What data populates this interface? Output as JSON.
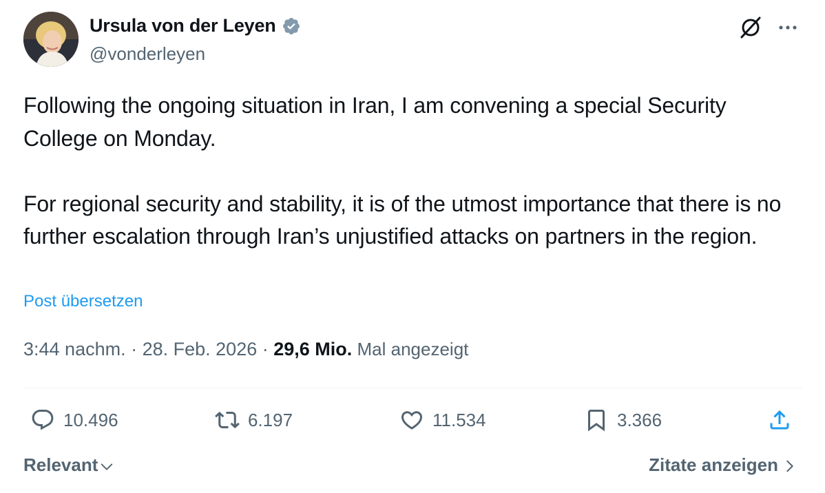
{
  "author": {
    "display_name": "Ursula von der Leyen",
    "handle": "@vonderleyen",
    "verified_icon": "verified-badge-icon",
    "badge_color": "#829aab"
  },
  "tweet": {
    "text": "Following the ongoing situation in Iran, I am convening a special Security College on Monday.\n\nFor regional security and stability, it is of the utmost importance that there is no further escalation through Iran’s unjustified attacks on partners in the region.",
    "translate_label": "Post übersetzen"
  },
  "meta": {
    "time": "3:44 nachm.",
    "sep1": " · ",
    "date": "28. Feb. 2026",
    "sep2": " · ",
    "views": "29,6 Mio.",
    "views_label": " Mal angezeigt"
  },
  "actions": {
    "replies": "10.496",
    "reposts": "6.197",
    "likes": "11.534",
    "bookmarks": "3.366"
  },
  "footer": {
    "sort_label": "Relevant",
    "quotes_label": "Zitate anzeigen"
  },
  "colors": {
    "text_primary": "#0f1419",
    "text_secondary": "#536471",
    "link": "#1d9bf0",
    "divider": "#eff3f4"
  }
}
